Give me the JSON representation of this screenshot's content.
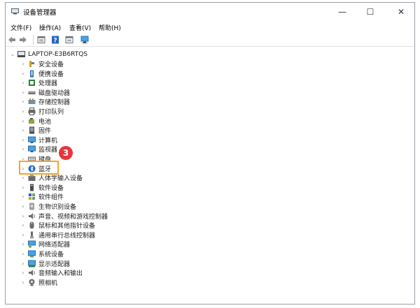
{
  "window": {
    "title": "设备管理器",
    "controls": {
      "minimize": "—",
      "maximize": "☐",
      "close": "✕"
    }
  },
  "menu": [
    "文件(F)",
    "操作(A)",
    "查看(V)",
    "帮助(H)"
  ],
  "toolbar_icons": [
    "back-arrow-icon",
    "forward-arrow-icon",
    "properties-icon",
    "help-icon",
    "show-hidden-icon",
    "monitor-icon"
  ],
  "tree": {
    "root": "LAPTOP-E3B6RTQS",
    "items": [
      {
        "label": "安全设备",
        "icon": "security-key-icon"
      },
      {
        "label": "便携设备",
        "icon": "portable-device-icon"
      },
      {
        "label": "处理器",
        "icon": "processor-icon"
      },
      {
        "label": "磁盘驱动器",
        "icon": "disk-drive-icon"
      },
      {
        "label": "存储控制器",
        "icon": "storage-controller-icon"
      },
      {
        "label": "打印队列",
        "icon": "printer-icon"
      },
      {
        "label": "电池",
        "icon": "battery-icon"
      },
      {
        "label": "固件",
        "icon": "firmware-icon"
      },
      {
        "label": "计算机",
        "icon": "computer-icon"
      },
      {
        "label": "监视器",
        "icon": "monitor-icon"
      },
      {
        "label": "键盘",
        "icon": "keyboard-icon"
      },
      {
        "label": "蓝牙",
        "icon": "bluetooth-icon"
      },
      {
        "label": "人体学输入设备",
        "icon": "hid-icon"
      },
      {
        "label": "软件设备",
        "icon": "software-device-icon"
      },
      {
        "label": "软件组件",
        "icon": "software-component-icon"
      },
      {
        "label": "生物识别设备",
        "icon": "biometric-icon"
      },
      {
        "label": "声音、视频和游戏控制器",
        "icon": "speaker-icon"
      },
      {
        "label": "鼠标和其他指针设备",
        "icon": "mouse-icon"
      },
      {
        "label": "通用串行总线控制器",
        "icon": "usb-icon"
      },
      {
        "label": "网络适配器",
        "icon": "network-adapter-icon"
      },
      {
        "label": "系统设备",
        "icon": "system-device-icon"
      },
      {
        "label": "显示适配器",
        "icon": "display-adapter-icon"
      },
      {
        "label": "音频输入和输出",
        "icon": "audio-io-icon"
      },
      {
        "label": "照相机",
        "icon": "camera-icon"
      }
    ]
  },
  "annotation": {
    "step": "3",
    "highlight_color": "#f6a623",
    "badge_color": "#e8353d"
  }
}
